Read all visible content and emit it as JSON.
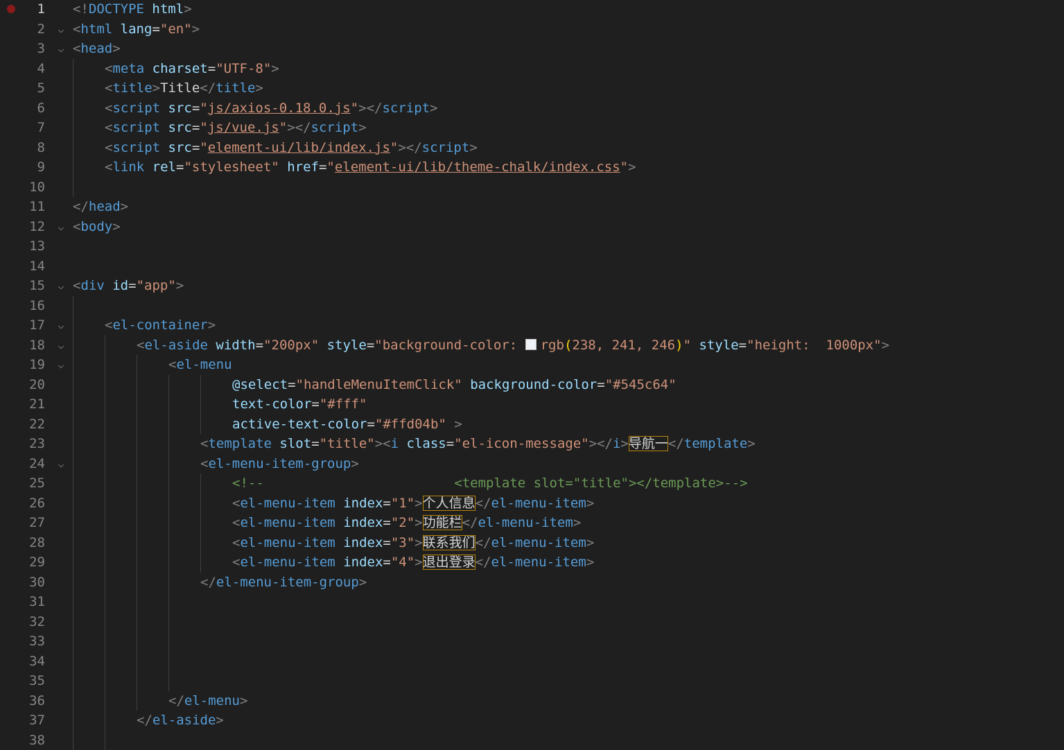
{
  "editor": {
    "language": "html",
    "active_line": 1,
    "breakpoint_line": 1,
    "lines": [
      {
        "n": "1",
        "fold": false,
        "indent": 0,
        "tokens": [
          [
            "pu",
            "<!"
          ],
          [
            "tg",
            "DOCTYPE"
          ],
          [
            "tx",
            " "
          ],
          [
            "at",
            "html"
          ],
          [
            "pu",
            ">"
          ]
        ]
      },
      {
        "n": "2",
        "fold": true,
        "indent": 0,
        "tokens": [
          [
            "pu",
            "<"
          ],
          [
            "tg",
            "html"
          ],
          [
            "tx",
            " "
          ],
          [
            "at",
            "lang"
          ],
          [
            "tx",
            "="
          ],
          [
            "st",
            "\"en\""
          ],
          [
            "pu",
            ">"
          ]
        ]
      },
      {
        "n": "3",
        "fold": true,
        "indent": 0,
        "tokens": [
          [
            "pu",
            "<"
          ],
          [
            "tg",
            "head"
          ],
          [
            "pu",
            ">"
          ]
        ]
      },
      {
        "n": "4",
        "fold": false,
        "indent": 1,
        "tokens": [
          [
            "pu",
            "<"
          ],
          [
            "tg",
            "meta"
          ],
          [
            "tx",
            " "
          ],
          [
            "at",
            "charset"
          ],
          [
            "tx",
            "="
          ],
          [
            "st",
            "\"UTF-8\""
          ],
          [
            "pu",
            ">"
          ]
        ]
      },
      {
        "n": "5",
        "fold": false,
        "indent": 1,
        "tokens": [
          [
            "pu",
            "<"
          ],
          [
            "tg",
            "title"
          ],
          [
            "pu",
            ">"
          ],
          [
            "tx",
            "Title"
          ],
          [
            "pu",
            "</"
          ],
          [
            "tg",
            "title"
          ],
          [
            "pu",
            ">"
          ]
        ]
      },
      {
        "n": "6",
        "fold": false,
        "indent": 1,
        "tokens": [
          [
            "pu",
            "<"
          ],
          [
            "tg",
            "script"
          ],
          [
            "tx",
            " "
          ],
          [
            "at",
            "src"
          ],
          [
            "tx",
            "="
          ],
          [
            "st",
            "\""
          ],
          [
            "st u",
            "js/axios-0.18.0.js"
          ],
          [
            "st",
            "\""
          ],
          [
            "pu",
            "></"
          ],
          [
            "tg",
            "script"
          ],
          [
            "pu",
            ">"
          ]
        ]
      },
      {
        "n": "7",
        "fold": false,
        "indent": 1,
        "tokens": [
          [
            "pu",
            "<"
          ],
          [
            "tg",
            "script"
          ],
          [
            "tx",
            " "
          ],
          [
            "at",
            "src"
          ],
          [
            "tx",
            "="
          ],
          [
            "st",
            "\""
          ],
          [
            "st u",
            "js/vue.js"
          ],
          [
            "st",
            "\""
          ],
          [
            "pu",
            "></"
          ],
          [
            "tg",
            "script"
          ],
          [
            "pu",
            ">"
          ]
        ]
      },
      {
        "n": "8",
        "fold": false,
        "indent": 1,
        "tokens": [
          [
            "pu",
            "<"
          ],
          [
            "tg",
            "script"
          ],
          [
            "tx",
            " "
          ],
          [
            "at",
            "src"
          ],
          [
            "tx",
            "="
          ],
          [
            "st",
            "\""
          ],
          [
            "st u",
            "element-ui/lib/index.js"
          ],
          [
            "st",
            "\""
          ],
          [
            "pu",
            "></"
          ],
          [
            "tg",
            "script"
          ],
          [
            "pu",
            ">"
          ]
        ]
      },
      {
        "n": "9",
        "fold": false,
        "indent": 1,
        "tokens": [
          [
            "pu",
            "<"
          ],
          [
            "tg",
            "link"
          ],
          [
            "tx",
            " "
          ],
          [
            "at",
            "rel"
          ],
          [
            "tx",
            "="
          ],
          [
            "st",
            "\"stylesheet\""
          ],
          [
            "tx",
            " "
          ],
          [
            "at",
            "href"
          ],
          [
            "tx",
            "="
          ],
          [
            "st",
            "\""
          ],
          [
            "st u",
            "element-ui/lib/theme-chalk/index.css"
          ],
          [
            "st",
            "\""
          ],
          [
            "pu",
            ">"
          ]
        ]
      },
      {
        "n": "10",
        "fold": false,
        "indent": 0,
        "tokens": []
      },
      {
        "n": "11",
        "fold": false,
        "indent": 0,
        "tokens": [
          [
            "pu",
            "</"
          ],
          [
            "tg",
            "head"
          ],
          [
            "pu",
            ">"
          ]
        ]
      },
      {
        "n": "12",
        "fold": true,
        "indent": 0,
        "tokens": [
          [
            "pu",
            "<"
          ],
          [
            "tg",
            "body"
          ],
          [
            "pu",
            ">"
          ]
        ]
      },
      {
        "n": "13",
        "fold": false,
        "indent": 0,
        "tokens": []
      },
      {
        "n": "14",
        "fold": false,
        "indent": 0,
        "tokens": []
      },
      {
        "n": "15",
        "fold": true,
        "indent": 0,
        "tokens": [
          [
            "pu",
            "<"
          ],
          [
            "tg",
            "div"
          ],
          [
            "tx",
            " "
          ],
          [
            "at",
            "id"
          ],
          [
            "tx",
            "="
          ],
          [
            "st",
            "\"app\""
          ],
          [
            "pu",
            ">"
          ]
        ]
      },
      {
        "n": "16",
        "fold": false,
        "indent": 0,
        "tokens": []
      },
      {
        "n": "17",
        "fold": true,
        "indent": 1,
        "tokens": [
          [
            "pu",
            "<"
          ],
          [
            "tg",
            "el-container"
          ],
          [
            "pu",
            ">"
          ]
        ]
      },
      {
        "n": "18",
        "fold": true,
        "indent": 2,
        "tokens": [
          [
            "pu",
            "<"
          ],
          [
            "tg",
            "el-aside"
          ],
          [
            "tx",
            " "
          ],
          [
            "at",
            "width"
          ],
          [
            "tx",
            "="
          ],
          [
            "st",
            "\"200px\""
          ],
          [
            "tx",
            " "
          ],
          [
            "at",
            "style"
          ],
          [
            "tx",
            "="
          ],
          [
            "st",
            "\"background-color: "
          ],
          [
            "swatch",
            ""
          ],
          [
            "st",
            "rgb"
          ],
          [
            "yl",
            "("
          ],
          [
            "st",
            "238, 241, 246"
          ],
          [
            "yl",
            ")"
          ],
          [
            "st",
            "\""
          ],
          [
            "tx",
            " "
          ],
          [
            "at",
            "style"
          ],
          [
            "tx",
            "="
          ],
          [
            "st",
            "\"height:  1000px\""
          ],
          [
            "pu",
            ">"
          ]
        ]
      },
      {
        "n": "19",
        "fold": true,
        "indent": 3,
        "tokens": [
          [
            "pu",
            "<"
          ],
          [
            "tg",
            "el-menu"
          ]
        ]
      },
      {
        "n": "20",
        "fold": false,
        "indent": 5,
        "tokens": [
          [
            "at",
            "@select"
          ],
          [
            "tx",
            "="
          ],
          [
            "st",
            "\"handleMenuItemClick\""
          ],
          [
            "tx",
            " "
          ],
          [
            "at",
            "background-color"
          ],
          [
            "tx",
            "="
          ],
          [
            "st",
            "\"#545c64\""
          ]
        ]
      },
      {
        "n": "21",
        "fold": false,
        "indent": 5,
        "tokens": [
          [
            "at",
            "text-color"
          ],
          [
            "tx",
            "="
          ],
          [
            "st",
            "\"#fff\""
          ]
        ]
      },
      {
        "n": "22",
        "fold": false,
        "indent": 5,
        "tokens": [
          [
            "at",
            "active-text-color"
          ],
          [
            "tx",
            "="
          ],
          [
            "st",
            "\"#ffd04b\""
          ],
          [
            "tx",
            " "
          ],
          [
            "pu",
            ">"
          ]
        ]
      },
      {
        "n": "23",
        "fold": false,
        "indent": 4,
        "tokens": [
          [
            "pu",
            "<"
          ],
          [
            "tg",
            "template"
          ],
          [
            "tx",
            " "
          ],
          [
            "at",
            "slot"
          ],
          [
            "tx",
            "="
          ],
          [
            "st",
            "\"title\""
          ],
          [
            "pu",
            "><"
          ],
          [
            "tg",
            "i"
          ],
          [
            "tx",
            " "
          ],
          [
            "at",
            "class"
          ],
          [
            "tx",
            "="
          ],
          [
            "st",
            "\"el-icon-message\""
          ],
          [
            "pu",
            "></"
          ],
          [
            "tg",
            "i"
          ],
          [
            "pu",
            ">"
          ],
          [
            "tx box",
            "导航一"
          ],
          [
            "pu",
            "</"
          ],
          [
            "tg",
            "template"
          ],
          [
            "pu",
            ">"
          ]
        ]
      },
      {
        "n": "24",
        "fold": true,
        "indent": 4,
        "tokens": [
          [
            "pu",
            "<"
          ],
          [
            "tg",
            "el-menu-item-group"
          ],
          [
            "pu",
            ">"
          ]
        ]
      },
      {
        "n": "25",
        "fold": false,
        "indent": 5,
        "tokens": [
          [
            "cm",
            "<!--                        <template slot=\"title\"></template>-->"
          ]
        ]
      },
      {
        "n": "26",
        "fold": false,
        "indent": 5,
        "tokens": [
          [
            "pu",
            "<"
          ],
          [
            "tg",
            "el-menu-item"
          ],
          [
            "tx",
            " "
          ],
          [
            "at",
            "index"
          ],
          [
            "tx",
            "="
          ],
          [
            "st",
            "\"1\""
          ],
          [
            "pu",
            ">"
          ],
          [
            "tx box",
            "个人信息"
          ],
          [
            "pu",
            "</"
          ],
          [
            "tg",
            "el-menu-item"
          ],
          [
            "pu",
            ">"
          ]
        ]
      },
      {
        "n": "27",
        "fold": false,
        "indent": 5,
        "tokens": [
          [
            "pu",
            "<"
          ],
          [
            "tg",
            "el-menu-item"
          ],
          [
            "tx",
            " "
          ],
          [
            "at",
            "index"
          ],
          [
            "tx",
            "="
          ],
          [
            "st",
            "\"2\""
          ],
          [
            "pu",
            ">"
          ],
          [
            "tx box",
            "功能栏"
          ],
          [
            "pu",
            "</"
          ],
          [
            "tg",
            "el-menu-item"
          ],
          [
            "pu",
            ">"
          ]
        ]
      },
      {
        "n": "28",
        "fold": false,
        "indent": 5,
        "tokens": [
          [
            "pu",
            "<"
          ],
          [
            "tg",
            "el-menu-item"
          ],
          [
            "tx",
            " "
          ],
          [
            "at",
            "index"
          ],
          [
            "tx",
            "="
          ],
          [
            "st",
            "\"3\""
          ],
          [
            "pu",
            ">"
          ],
          [
            "tx box",
            "联系我们"
          ],
          [
            "pu",
            "</"
          ],
          [
            "tg",
            "el-menu-item"
          ],
          [
            "pu",
            ">"
          ]
        ]
      },
      {
        "n": "29",
        "fold": false,
        "indent": 5,
        "tokens": [
          [
            "pu",
            "<"
          ],
          [
            "tg",
            "el-menu-item"
          ],
          [
            "tx",
            " "
          ],
          [
            "at",
            "index"
          ],
          [
            "tx",
            "="
          ],
          [
            "st",
            "\"4\""
          ],
          [
            "pu",
            ">"
          ],
          [
            "tx box",
            "退出登录"
          ],
          [
            "pu",
            "</"
          ],
          [
            "tg",
            "el-menu-item"
          ],
          [
            "pu",
            ">"
          ]
        ]
      },
      {
        "n": "30",
        "fold": false,
        "indent": 4,
        "tokens": [
          [
            "pu",
            "</"
          ],
          [
            "tg",
            "el-menu-item-group"
          ],
          [
            "pu",
            ">"
          ]
        ]
      },
      {
        "n": "31",
        "fold": false,
        "indent": 0,
        "tokens": []
      },
      {
        "n": "32",
        "fold": false,
        "indent": 0,
        "tokens": []
      },
      {
        "n": "33",
        "fold": false,
        "indent": 0,
        "tokens": []
      },
      {
        "n": "34",
        "fold": false,
        "indent": 0,
        "tokens": []
      },
      {
        "n": "35",
        "fold": false,
        "indent": 0,
        "tokens": []
      },
      {
        "n": "36",
        "fold": false,
        "indent": 3,
        "tokens": [
          [
            "pu",
            "</"
          ],
          [
            "tg",
            "el-menu"
          ],
          [
            "pu",
            ">"
          ]
        ]
      },
      {
        "n": "37",
        "fold": false,
        "indent": 2,
        "tokens": [
          [
            "pu",
            "</"
          ],
          [
            "tg",
            "el-aside"
          ],
          [
            "pu",
            ">"
          ]
        ]
      },
      {
        "n": "38",
        "fold": false,
        "indent": 0,
        "tokens": []
      }
    ],
    "colors": {
      "background": "#1f1f1f",
      "line_number": "#858585",
      "tag": "#569cd6",
      "attribute": "#9cdcfe",
      "string": "#ce9178",
      "comment": "#6a9955",
      "bracket": "#ffd700",
      "highlight_box": "#b8860b"
    }
  }
}
